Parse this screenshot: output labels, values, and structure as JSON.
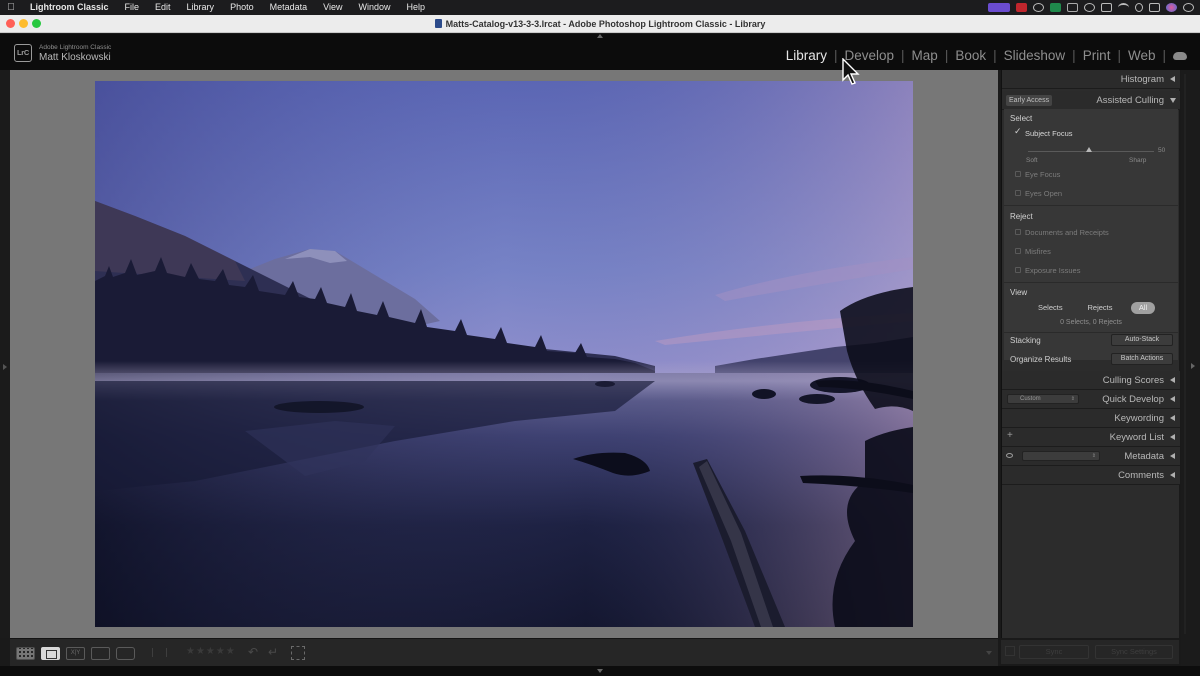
{
  "menubar": {
    "app": "Lightroom Classic",
    "items": [
      "File",
      "Edit",
      "Library",
      "Photo",
      "Metadata",
      "View",
      "Window",
      "Help"
    ]
  },
  "window": {
    "title": "Matts-Catalog-v13-3-3.lrcat - Adobe Photoshop Lightroom Classic - Library"
  },
  "identity": {
    "logo": "LrC",
    "product": "Adobe Lightroom Classic",
    "user": "Matt Kloskowski"
  },
  "modules": {
    "items": [
      "Library",
      "Develop",
      "Map",
      "Book",
      "Slideshow",
      "Print",
      "Web"
    ],
    "active": "Library"
  },
  "right_panel": {
    "histogram": {
      "label": "Histogram"
    },
    "assisted_culling": {
      "badge": "Early Access",
      "label": "Assisted Culling",
      "select": {
        "title": "Select",
        "subject_focus": {
          "label": "Subject Focus",
          "checked": true
        },
        "slider": {
          "value": "50",
          "min_label": "Soft",
          "max_label": "Sharp",
          "level": 0.5
        },
        "eye_focus": {
          "label": "Eye Focus",
          "checked": false
        },
        "eyes_open": {
          "label": "Eyes Open",
          "checked": false
        }
      },
      "reject": {
        "title": "Reject",
        "documents": {
          "label": "Documents and Receipts",
          "checked": false
        },
        "misfires": {
          "label": "Misfires",
          "checked": false
        },
        "exposure": {
          "label": "Exposure Issues",
          "checked": false
        }
      },
      "view": {
        "title": "View",
        "buttons": [
          "Selects",
          "Rejects",
          "All"
        ],
        "active": "All",
        "counts": "0 Selects, 0 Rejects"
      },
      "stacking": {
        "label": "Stacking",
        "button": "Auto-Stack"
      },
      "organize": {
        "label": "Organize Results",
        "button": "Batch Actions"
      }
    },
    "culling_scores": {
      "label": "Culling Scores"
    },
    "quick_develop": {
      "label": "Quick Develop",
      "preset": "Custom"
    },
    "keywording": {
      "label": "Keywording"
    },
    "keyword_list": {
      "label": "Keyword List"
    },
    "metadata": {
      "label": "Metadata"
    },
    "comments": {
      "label": "Comments"
    },
    "bottom": {
      "sync": "Sync",
      "sync_settings": "Sync Settings"
    }
  },
  "toolbar": {
    "views": [
      "grid-view",
      "loupe-view",
      "compare-view",
      "survey-view",
      "people-view"
    ],
    "active_view": "loupe-view",
    "compare_label": "X|Y",
    "rating": "★★★★★"
  },
  "colors": {
    "menubar_bg": "#1c1c1e",
    "panel_bg": "#2c2c2c",
    "loupe_bg": "#777777",
    "text_active": "#e6e6e6",
    "text_inactive": "#8e8e8e"
  }
}
